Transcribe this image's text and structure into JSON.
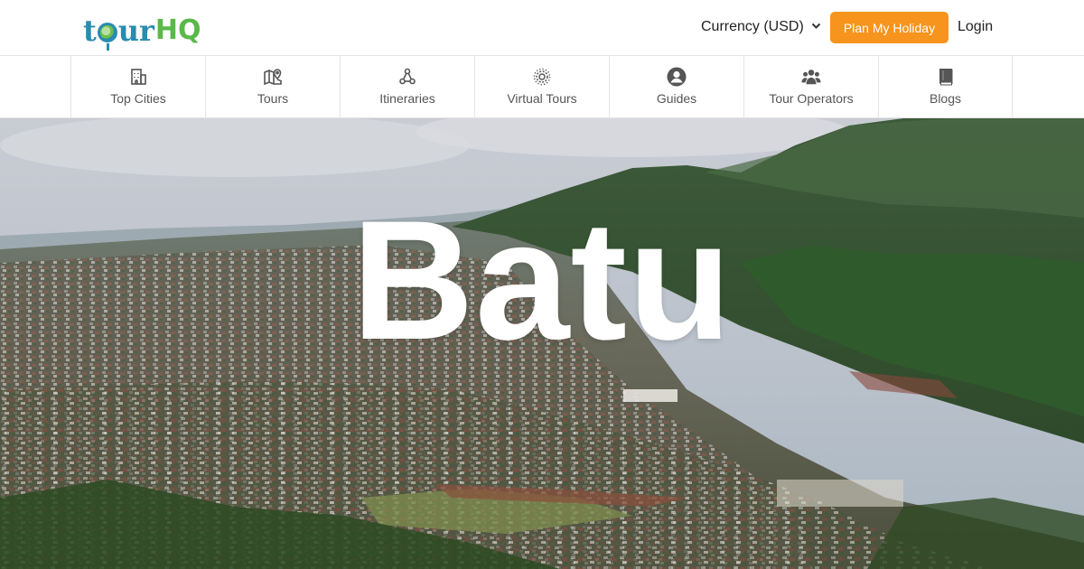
{
  "brand": {
    "logo_text": "tourHQ"
  },
  "header": {
    "currency_label": "Currency (USD)",
    "plan_button": "Plan My Holiday",
    "login_label": "Login"
  },
  "nav": {
    "items": [
      {
        "label": "Top Cities",
        "icon": "building-icon"
      },
      {
        "label": "Tours",
        "icon": "map-pin-icon"
      },
      {
        "label": "Itineraries",
        "icon": "route-nodes-icon"
      },
      {
        "label": "Virtual Tours",
        "icon": "virtual-target-icon"
      },
      {
        "label": "Guides",
        "icon": "user-circle-icon"
      },
      {
        "label": "Tour Operators",
        "icon": "users-group-icon"
      },
      {
        "label": "Blogs",
        "icon": "book-icon"
      }
    ]
  },
  "hero": {
    "title": "Batu"
  },
  "colors": {
    "accent": "#f7941d",
    "logo_blue": "#2a8bb0",
    "logo_green": "#5bb84a"
  }
}
